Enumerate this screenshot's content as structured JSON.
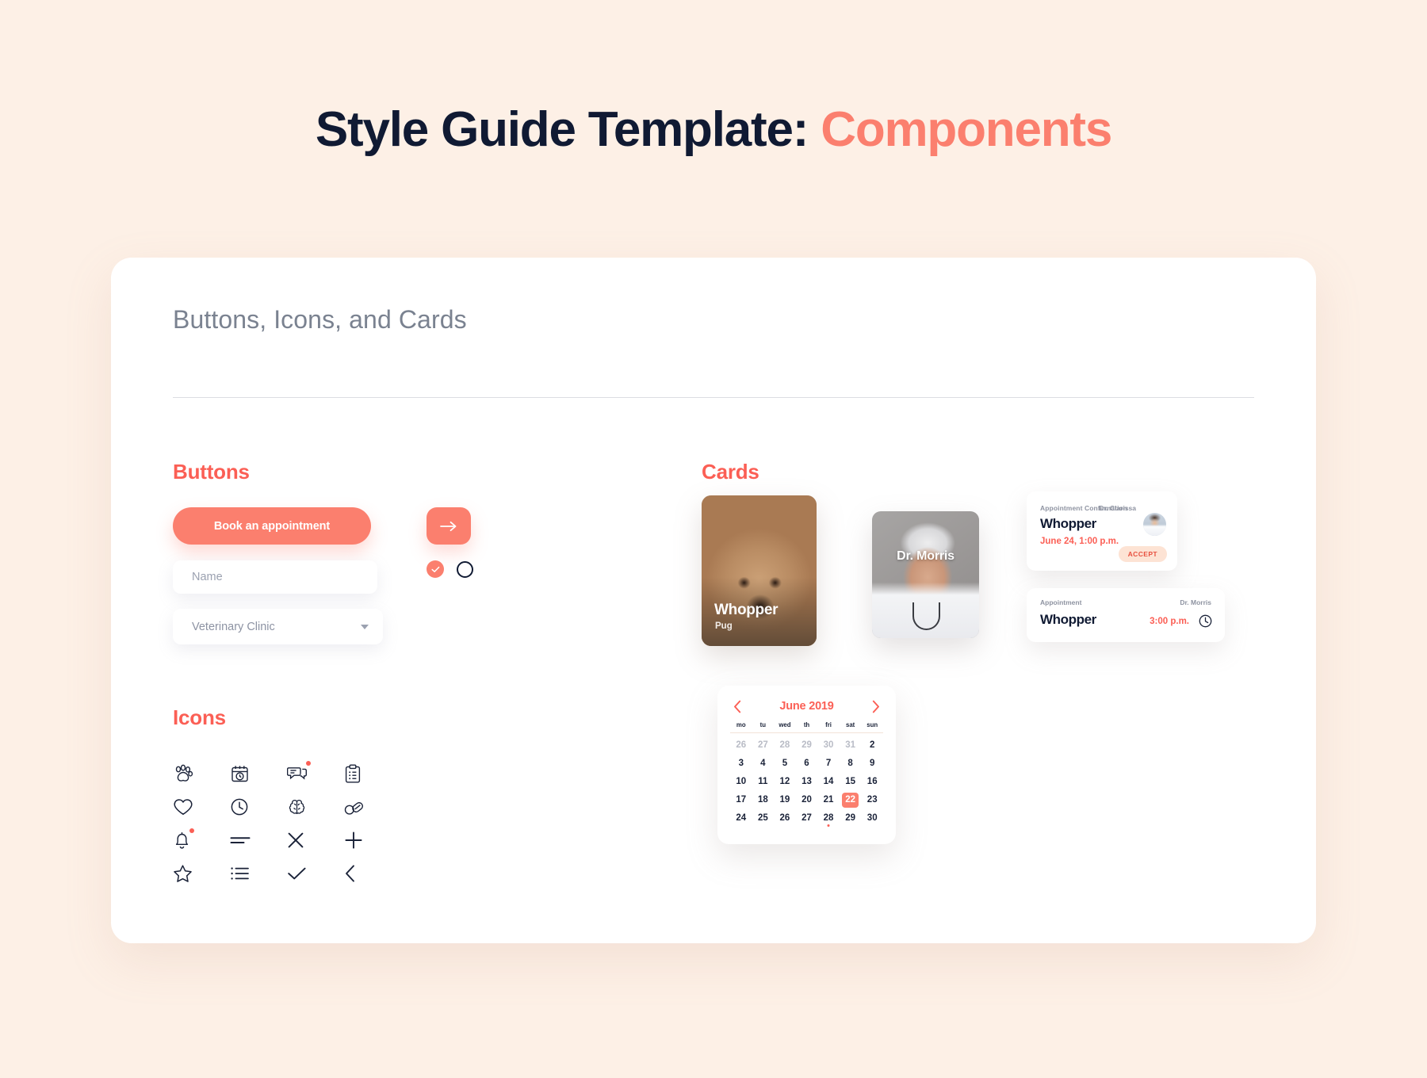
{
  "title": {
    "main": "Style Guide Template: ",
    "accent": "Components"
  },
  "panel": {
    "heading": "Buttons, Icons, and Cards"
  },
  "sections": {
    "buttons": "Buttons",
    "icons": "Icons",
    "cards": "Cards"
  },
  "buttons": {
    "primary_label": "Book an appointment",
    "name_placeholder": "Name",
    "select_value": "Veterinary Clinic",
    "arrow_icon": "arrow-right-icon",
    "checkbox_icon": "check-icon",
    "radio_icon": "radio-empty-icon"
  },
  "icons": [
    {
      "name": "paw-icon",
      "label": "paw"
    },
    {
      "name": "calendar-clock-icon",
      "label": "calendar clock"
    },
    {
      "name": "chat-bubbles-icon",
      "label": "chat bubbles",
      "badge": true
    },
    {
      "name": "clipboard-icon",
      "label": "clipboard"
    },
    {
      "name": "heart-icon",
      "label": "heart"
    },
    {
      "name": "clock-icon",
      "label": "clock"
    },
    {
      "name": "brain-icon",
      "label": "brain"
    },
    {
      "name": "pills-icon",
      "label": "pills"
    },
    {
      "name": "bell-icon",
      "label": "bell",
      "badge": true
    },
    {
      "name": "align-left-icon",
      "label": "align left"
    },
    {
      "name": "close-icon",
      "label": "close"
    },
    {
      "name": "plus-icon",
      "label": "plus"
    },
    {
      "name": "star-icon",
      "label": "star"
    },
    {
      "name": "list-icon",
      "label": "list"
    },
    {
      "name": "check-icon",
      "label": "check"
    },
    {
      "name": "chevron-left-icon",
      "label": "chevron left"
    }
  ],
  "cards": {
    "pet": {
      "name": "Whopper",
      "breed": "Pug"
    },
    "doctor": {
      "name": "Dr. Morris"
    },
    "appointment_confirmation": {
      "label": "Appointment Confirmation",
      "doctor": "Dr. Clarissa",
      "pet": "Whopper",
      "datetime": "June 24, 1:00 p.m.",
      "accept_label": "ACCEPT"
    },
    "appointment_simple": {
      "label": "Appointment",
      "doctor": "Dr. Morris",
      "pet": "Whopper",
      "time": "3:00 p.m.",
      "clock_icon": "clock-icon"
    }
  },
  "calendar": {
    "month": "June 2019",
    "prev_icon": "chevron-left-icon",
    "next_icon": "chevron-right-icon",
    "day_labels": [
      "mo",
      "tu",
      "wed",
      "th",
      "fri",
      "sat",
      "sun"
    ],
    "weeks": [
      [
        {
          "d": "26",
          "muted": true
        },
        {
          "d": "27",
          "muted": true
        },
        {
          "d": "28",
          "muted": true
        },
        {
          "d": "29",
          "muted": true
        },
        {
          "d": "30",
          "muted": true
        },
        {
          "d": "31",
          "muted": true
        },
        {
          "d": "2"
        }
      ],
      [
        {
          "d": "3"
        },
        {
          "d": "4"
        },
        {
          "d": "5"
        },
        {
          "d": "6"
        },
        {
          "d": "7"
        },
        {
          "d": "8"
        },
        {
          "d": "9"
        }
      ],
      [
        {
          "d": "10"
        },
        {
          "d": "11"
        },
        {
          "d": "12"
        },
        {
          "d": "13"
        },
        {
          "d": "14"
        },
        {
          "d": "15"
        },
        {
          "d": "16"
        }
      ],
      [
        {
          "d": "17"
        },
        {
          "d": "18"
        },
        {
          "d": "19"
        },
        {
          "d": "20"
        },
        {
          "d": "21"
        },
        {
          "d": "22",
          "selected": true
        },
        {
          "d": "23"
        }
      ],
      [
        {
          "d": "24"
        },
        {
          "d": "25"
        },
        {
          "d": "26"
        },
        {
          "d": "27"
        },
        {
          "d": "28",
          "dot": true
        },
        {
          "d": "29"
        },
        {
          "d": "30"
        }
      ]
    ]
  },
  "colors": {
    "background": "#FDF0E6",
    "panel": "#FFFFFF",
    "accent": "#FB7F6E",
    "accent_text": "#FB5F55",
    "dark": "#101A33",
    "muted": "#7A8290"
  }
}
